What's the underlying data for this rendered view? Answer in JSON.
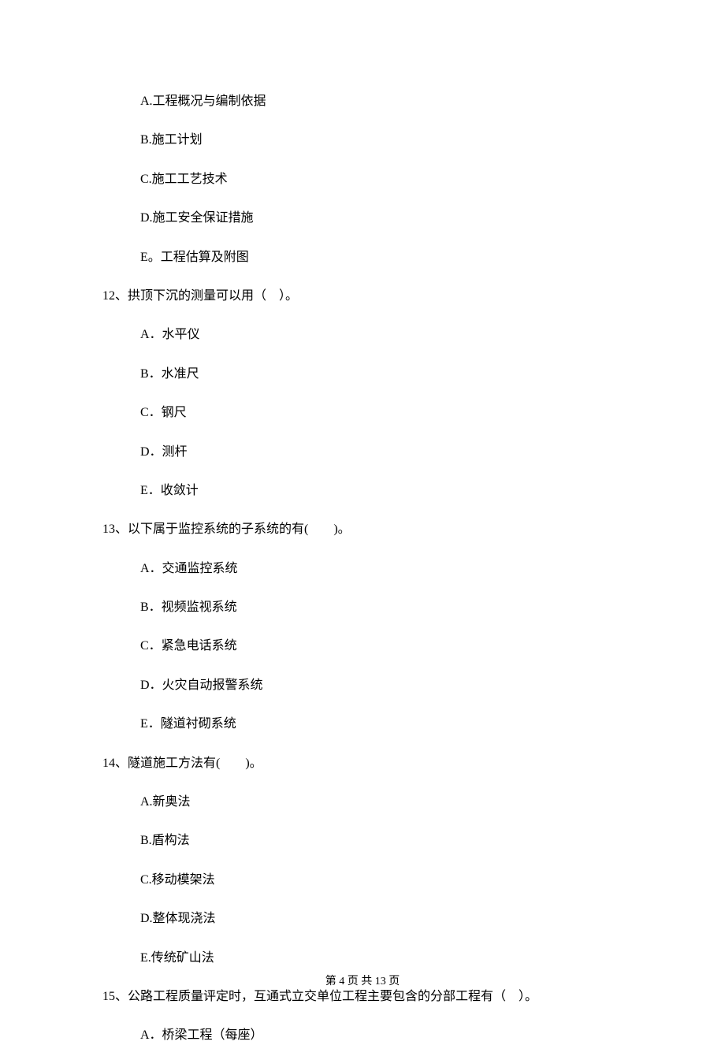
{
  "options_block1": {
    "a": "A.工程概况与编制依据",
    "b": "B.施工计划",
    "c": "C.施工工艺技术",
    "d": "D.施工安全保证措施",
    "e": "E。工程估算及附图"
  },
  "q12": {
    "text": "12、拱顶下沉的测量可以用（　）。",
    "a": "A．水平仪",
    "b": "B．水准尺",
    "c": "C．钢尺",
    "d": "D．测杆",
    "e": "E．收敛计"
  },
  "q13": {
    "text": "13、以下属于监控系统的子系统的有(　　)。",
    "a": "A．交通监控系统",
    "b": "B．视频监视系统",
    "c": "C．紧急电话系统",
    "d": "D．火灾自动报警系统",
    "e": "E．隧道衬砌系统"
  },
  "q14": {
    "text": "14、隧道施工方法有(　　)。",
    "a": "A.新奥法",
    "b": "B.盾构法",
    "c": "C.移动模架法",
    "d": "D.整体现浇法",
    "e": "E.传统矿山法"
  },
  "q15": {
    "text": "15、公路工程质量评定时，互通式立交单位工程主要包含的分部工程有（　）。",
    "a": "A．桥梁工程（每座）"
  },
  "footer": "第 4 页 共 13 页"
}
